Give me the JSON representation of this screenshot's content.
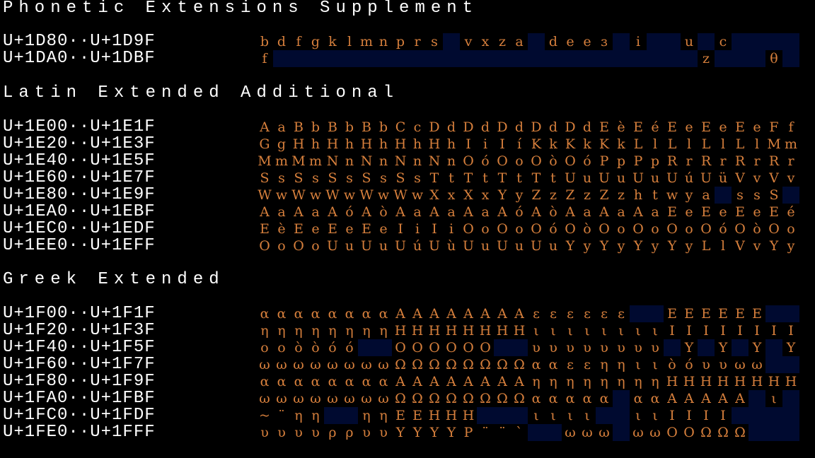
{
  "colors": {
    "background": "#000000",
    "label": "#ffffff",
    "glyph": "#d67f3c",
    "unassigned": "#000a30"
  },
  "sections": [
    {
      "title": "Phonetic Extensions Supplement",
      "rows": [
        {
          "range": "U+1D80··U+1D9F",
          "glyphs": [
            "b",
            "d",
            "f",
            "g",
            "k",
            "l",
            "m",
            "n",
            "p",
            "r",
            "s",
            "",
            "v",
            "x",
            "z",
            "a",
            "",
            "d",
            "e",
            "e",
            "ɜ",
            "",
            "i",
            "",
            "",
            "u",
            "",
            "c",
            "",
            "",
            "",
            ""
          ]
        },
        {
          "range": "U+1DA0··U+1DBF",
          "glyphs": [
            "f",
            "",
            "",
            "",
            "",
            "",
            "",
            "",
            "",
            "",
            "",
            "",
            "",
            "",
            "",
            "",
            "",
            "",
            "",
            "",
            "",
            "",
            "",
            "",
            "",
            "",
            "z",
            "",
            "",
            "",
            "θ",
            ""
          ]
        }
      ]
    },
    {
      "title": "Latin Extended Additional",
      "rows": [
        {
          "range": "U+1E00··U+1E1F",
          "glyphs": [
            "A",
            "a",
            "B",
            "b",
            "B",
            "b",
            "B",
            "b",
            "C",
            "c",
            "D",
            "d",
            "D",
            "d",
            "D",
            "d",
            "D",
            "d",
            "D",
            "d",
            "E",
            "è",
            "E",
            "é",
            "E",
            "e",
            "E",
            "e",
            "E",
            "e",
            "F",
            "f"
          ]
        },
        {
          "range": "U+1E20··U+1E3F",
          "glyphs": [
            "G",
            "g",
            "H",
            "h",
            "H",
            "h",
            "H",
            "h",
            "H",
            "h",
            "H",
            "h",
            "I",
            "i",
            "I",
            "í",
            "K",
            "k",
            "K",
            "k",
            "K",
            "k",
            "L",
            "l",
            "L",
            "l",
            "L",
            "l",
            "L",
            "l",
            "M",
            "m"
          ]
        },
        {
          "range": "U+1E40··U+1E5F",
          "glyphs": [
            "M",
            "m",
            "M",
            "m",
            "N",
            "n",
            "N",
            "n",
            "N",
            "n",
            "N",
            "n",
            "O",
            "ó",
            "O",
            "o",
            "O",
            "ò",
            "O",
            "ó",
            "P",
            "p",
            "P",
            "p",
            "R",
            "r",
            "R",
            "r",
            "R",
            "r",
            "R",
            "r"
          ]
        },
        {
          "range": "U+1E60··U+1E7F",
          "glyphs": [
            "S",
            "s",
            "S",
            "s",
            "S",
            "s",
            "S",
            "s",
            "S",
            "s",
            "T",
            "t",
            "T",
            "t",
            "T",
            "t",
            "T",
            "t",
            "U",
            "u",
            "U",
            "u",
            "U",
            "u",
            "U",
            "ú",
            "U",
            "ü",
            "V",
            "v",
            "V",
            "v"
          ]
        },
        {
          "range": "U+1E80··U+1E9F",
          "glyphs": [
            "W",
            "w",
            "W",
            "w",
            "W",
            "w",
            "W",
            "w",
            "W",
            "w",
            "X",
            "x",
            "X",
            "x",
            "Y",
            "y",
            "Z",
            "z",
            "Z",
            "z",
            "Z",
            "z",
            "h",
            "t",
            "w",
            "y",
            "a",
            "",
            "s",
            "s",
            "S",
            ""
          ]
        },
        {
          "range": "U+1EA0··U+1EBF",
          "glyphs": [
            "A",
            "a",
            "A",
            "a",
            "A",
            "ó",
            "A",
            "ò",
            "A",
            "a",
            "A",
            "a",
            "A",
            "a",
            "A",
            "ó",
            "A",
            "ò",
            "A",
            "a",
            "A",
            "a",
            "A",
            "a",
            "E",
            "e",
            "E",
            "e",
            "E",
            "e",
            "E",
            "é"
          ]
        },
        {
          "range": "U+1EC0··U+1EDF",
          "glyphs": [
            "E",
            "è",
            "E",
            "e",
            "E",
            "e",
            "E",
            "e",
            "I",
            "i",
            "I",
            "i",
            "O",
            "o",
            "O",
            "o",
            "O",
            "ó",
            "O",
            "ò",
            "O",
            "o",
            "O",
            "o",
            "O",
            "o",
            "O",
            "ó",
            "O",
            "ò",
            "O",
            "o"
          ]
        },
        {
          "range": "U+1EE0··U+1EFF",
          "glyphs": [
            "O",
            "o",
            "O",
            "o",
            "U",
            "u",
            "U",
            "u",
            "U",
            "ú",
            "U",
            "ù",
            "U",
            "u",
            "U",
            "u",
            "U",
            "u",
            "Y",
            "y",
            "Y",
            "y",
            "Y",
            "y",
            "Y",
            "y",
            "L",
            "l",
            "V",
            "v",
            "Y",
            "y"
          ]
        }
      ]
    },
    {
      "title": "Greek Extended",
      "rows": [
        {
          "range": "U+1F00··U+1F1F",
          "glyphs": [
            "α",
            "α",
            "α",
            "α",
            "α",
            "α",
            "α",
            "α",
            "A",
            "A",
            "A",
            "A",
            "A",
            "A",
            "A",
            "A",
            "ε",
            "ε",
            "ε",
            "ε",
            "ε",
            "ε",
            "",
            "",
            "E",
            "E",
            "E",
            "E",
            "E",
            "E",
            "",
            ""
          ]
        },
        {
          "range": "U+1F20··U+1F3F",
          "glyphs": [
            "η",
            "η",
            "η",
            "η",
            "η",
            "η",
            "η",
            "η",
            "H",
            "H",
            "H",
            "H",
            "H",
            "H",
            "H",
            "H",
            "ι",
            "ι",
            "ι",
            "ι",
            "ι",
            "ι",
            "ι",
            "ι",
            "I",
            "I",
            "I",
            "I",
            "I",
            "I",
            "I",
            "I"
          ]
        },
        {
          "range": "U+1F40··U+1F5F",
          "glyphs": [
            "ο",
            "ο",
            "ὸ",
            "ὸ",
            "ό",
            "ό",
            "",
            "",
            "O",
            "O",
            "O",
            "O",
            "O",
            "O",
            "",
            "",
            "υ",
            "υ",
            "υ",
            "υ",
            "υ",
            "υ",
            "υ",
            "υ",
            "",
            "Υ",
            "",
            "Υ",
            "",
            "Υ",
            "",
            "Υ"
          ]
        },
        {
          "range": "U+1F60··U+1F7F",
          "glyphs": [
            "ω",
            "ω",
            "ω",
            "ω",
            "ω",
            "ω",
            "ω",
            "ω",
            "Ω",
            "Ω",
            "Ω",
            "Ω",
            "Ω",
            "Ω",
            "Ω",
            "Ω",
            "α",
            "α",
            "ε",
            "ε",
            "η",
            "η",
            "ι",
            "ι",
            "ὸ",
            "ό",
            "υ",
            "υ",
            "ω",
            "ω",
            "",
            ""
          ]
        },
        {
          "range": "U+1F80··U+1F9F",
          "glyphs": [
            "α",
            "α",
            "α",
            "α",
            "α",
            "α",
            "α",
            "α",
            "A",
            "A",
            "A",
            "A",
            "A",
            "A",
            "A",
            "A",
            "η",
            "η",
            "η",
            "η",
            "η",
            "η",
            "η",
            "η",
            "H",
            "H",
            "H",
            "H",
            "H",
            "H",
            "H",
            "H"
          ]
        },
        {
          "range": "U+1FA0··U+1FBF",
          "glyphs": [
            "ω",
            "ω",
            "ω",
            "ω",
            "ω",
            "ω",
            "ω",
            "ω",
            "Ω",
            "Ω",
            "Ω",
            "Ω",
            "Ω",
            "Ω",
            "Ω",
            "Ω",
            "α",
            "α",
            "α",
            "α",
            "α",
            "",
            "α",
            "α",
            "A",
            "A",
            "A",
            "A",
            "A",
            "",
            "ι",
            ""
          ]
        },
        {
          "range": "U+1FC0··U+1FDF",
          "glyphs": [
            "~",
            "¨",
            "η",
            "η",
            "",
            "",
            "η",
            "η",
            "E",
            "E",
            "H",
            "H",
            "H",
            "",
            "",
            "",
            "ι",
            "ι",
            "ι",
            "ι",
            "",
            "",
            "ι",
            "ι",
            "I",
            "I",
            "I",
            "I",
            "",
            "",
            "",
            ""
          ]
        },
        {
          "range": "U+1FE0··U+1FFF",
          "glyphs": [
            "υ",
            "υ",
            "υ",
            "υ",
            "ρ",
            "ρ",
            "υ",
            "υ",
            "Υ",
            "Υ",
            "Υ",
            "Υ",
            "P",
            "¨",
            "¨",
            "`",
            "",
            "",
            "ω",
            "ω",
            "ω",
            "",
            "ω",
            "ω",
            "O",
            "O",
            "Ω",
            "Ω",
            "Ω",
            "",
            "",
            ""
          ]
        }
      ]
    }
  ]
}
